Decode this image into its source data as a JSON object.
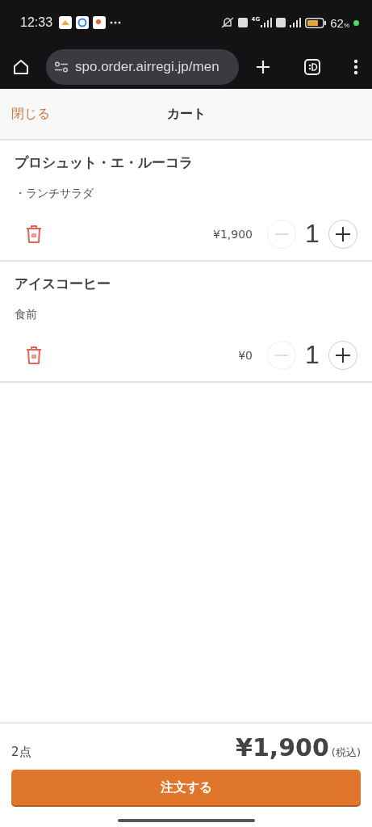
{
  "status_bar": {
    "time": "12:33",
    "network": "4G",
    "battery": "62",
    "battery_unit": "%"
  },
  "browser": {
    "url": "spo.order.airregi.jp/men"
  },
  "header": {
    "close": "閉じる",
    "title": "カート"
  },
  "items": [
    {
      "name": "プロシュット・エ・ルーコラ",
      "option": "・ランチサラダ",
      "price": "¥1,900",
      "quantity": "1",
      "minus_disabled": true
    },
    {
      "name": "アイスコーヒー",
      "option": "食前",
      "price": "¥0",
      "quantity": "1",
      "minus_disabled": true
    }
  ],
  "footer": {
    "count": "2点",
    "total": "¥1,900",
    "tax_note": "(税込)",
    "order_button": "注文する"
  }
}
